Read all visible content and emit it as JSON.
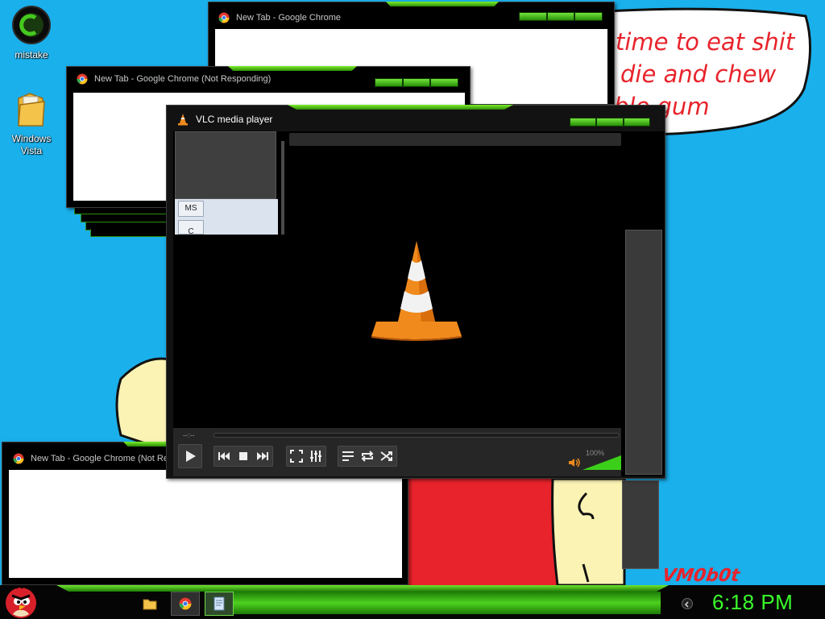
{
  "desktop": {
    "icons": [
      {
        "label": "mistake"
      },
      {
        "label": "Windows Vista"
      }
    ],
    "speech_lines": [
      "time to eat shit",
      "die and chew",
      "ble gum"
    ],
    "signature": "VM0b0t"
  },
  "windows": {
    "chrome_top": {
      "title": "New Tab - Google Chrome"
    },
    "chrome_mid": {
      "title": "New Tab - Google Chrome (Not Responding)"
    },
    "chrome_bottom": {
      "title": "New Tab - Google Chrome (Not Re"
    },
    "vlc": {
      "title": "VLC media player",
      "panel_buttons": [
        "MS",
        "C"
      ],
      "time_label": "--:--",
      "volume_label": "100%",
      "volume_level": 1.0,
      "controls": {
        "play": "play-icon",
        "previous": "previous-icon",
        "stop": "stop-icon",
        "next": "next-icon",
        "fullscreen": "fullscreen-icon",
        "extended": "equalizer-icon",
        "playlist": "playlist-icon",
        "loop": "loop-icon",
        "shuffle": "shuffle-icon"
      }
    }
  },
  "taskbar": {
    "clock": "6:18 PM",
    "items": [
      "folder-icon",
      "chrome-icon",
      "app-window-icon"
    ]
  },
  "colors": {
    "desktop_bg": "#1ab0ec",
    "accent_green": "#3ccf1a",
    "clock_green": "#39ff2a",
    "speech_red": "#e8232b",
    "vlc_orange": "#f08a1c"
  }
}
